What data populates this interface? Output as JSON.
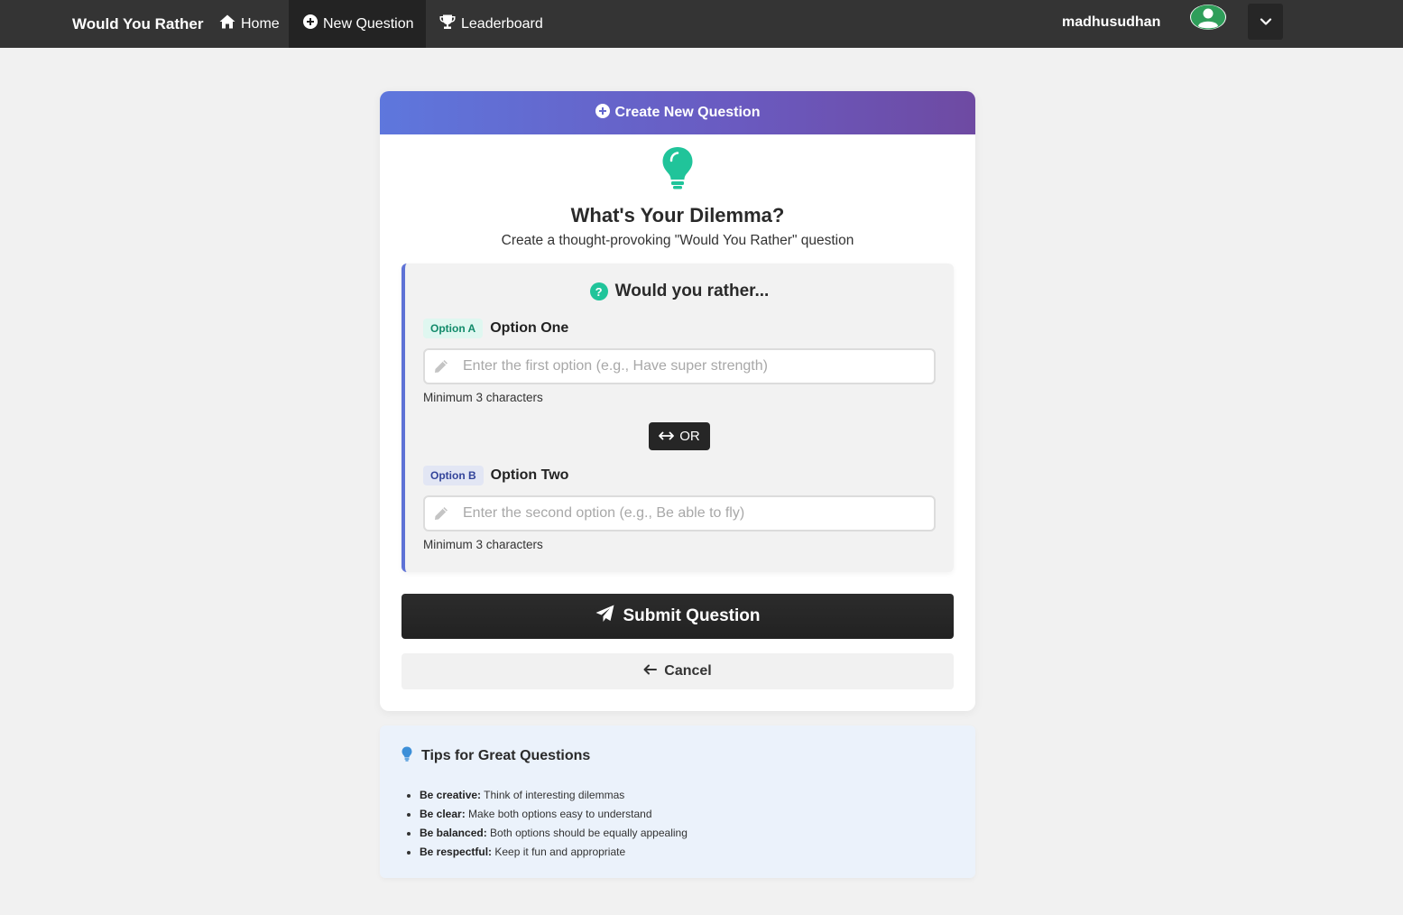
{
  "nav": {
    "brand": "Would You Rather",
    "links": [
      {
        "label": "Home",
        "icon": "home-icon"
      },
      {
        "label": "New Question",
        "icon": "plus-circle-icon",
        "active": true
      },
      {
        "label": "Leaderboard",
        "icon": "trophy-icon"
      }
    ],
    "username": "madhusudhan"
  },
  "card": {
    "header_title": "Create New Question",
    "title": "What's Your Dilemma?",
    "subtitle": "Create a thought-provoking \"Would You Rather\" question",
    "prompt": "Would you rather...",
    "option_a": {
      "badge": "Option A",
      "label": "Option One",
      "placeholder": "Enter the first option (e.g., Have super strength)",
      "value": "",
      "hint": "Minimum 3 characters"
    },
    "or_label": "OR",
    "option_b": {
      "badge": "Option B",
      "label": "Option Two",
      "placeholder": "Enter the second option (e.g., Be able to fly)",
      "value": "",
      "hint": "Minimum 3 characters"
    },
    "submit_label": "Submit Question",
    "cancel_label": "Cancel"
  },
  "tips": {
    "title": "Tips for Great Questions",
    "items": [
      {
        "term": "Be creative:",
        "text": "Think of interesting dilemmas"
      },
      {
        "term": "Be clear:",
        "text": "Make both options easy to understand"
      },
      {
        "term": "Be balanced:",
        "text": "Both options should be equally appealing"
      },
      {
        "term": "Be respectful:",
        "text": "Keep it fun and appropriate"
      }
    ]
  },
  "colors": {
    "navbar": "#343434",
    "accent_teal": "#20c49a",
    "accent_indigo": "#5e72d6",
    "header_gradient_start": "#5e77dd",
    "header_gradient_end": "#6e4aa2",
    "tips_bg": "#ebf2fb"
  }
}
